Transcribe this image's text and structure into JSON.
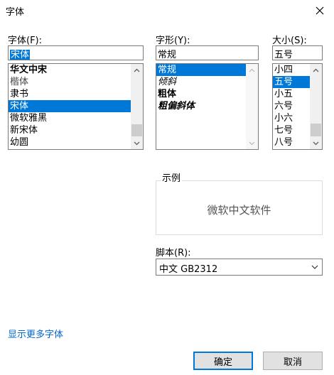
{
  "window": {
    "title": "字体"
  },
  "font": {
    "label": "字体(F):",
    "value": "宋体",
    "items": [
      "华文中宋",
      "楷体",
      "隶书",
      "宋体",
      "微软雅黑",
      "新宋体",
      "幼圆"
    ],
    "selected_index": 3
  },
  "style": {
    "label": "字形(Y):",
    "value": "常规",
    "items": [
      "常规",
      "倾斜",
      "粗体",
      "粗偏斜体"
    ],
    "selected_index": 0
  },
  "size": {
    "label": "大小(S):",
    "value": "五号",
    "items": [
      "小四",
      "五号",
      "小五",
      "六号",
      "小六",
      "七号",
      "八号"
    ],
    "selected_index": 1
  },
  "preview": {
    "legend": "示例",
    "sample": "微软中文软件"
  },
  "script": {
    "label": "脚本(R):",
    "value": "中文 GB2312"
  },
  "more_fonts_link": "显示更多字体",
  "buttons": {
    "ok": "确定",
    "cancel": "取消"
  },
  "colors": {
    "accent": "#0078d7",
    "link": "#0066cc"
  }
}
